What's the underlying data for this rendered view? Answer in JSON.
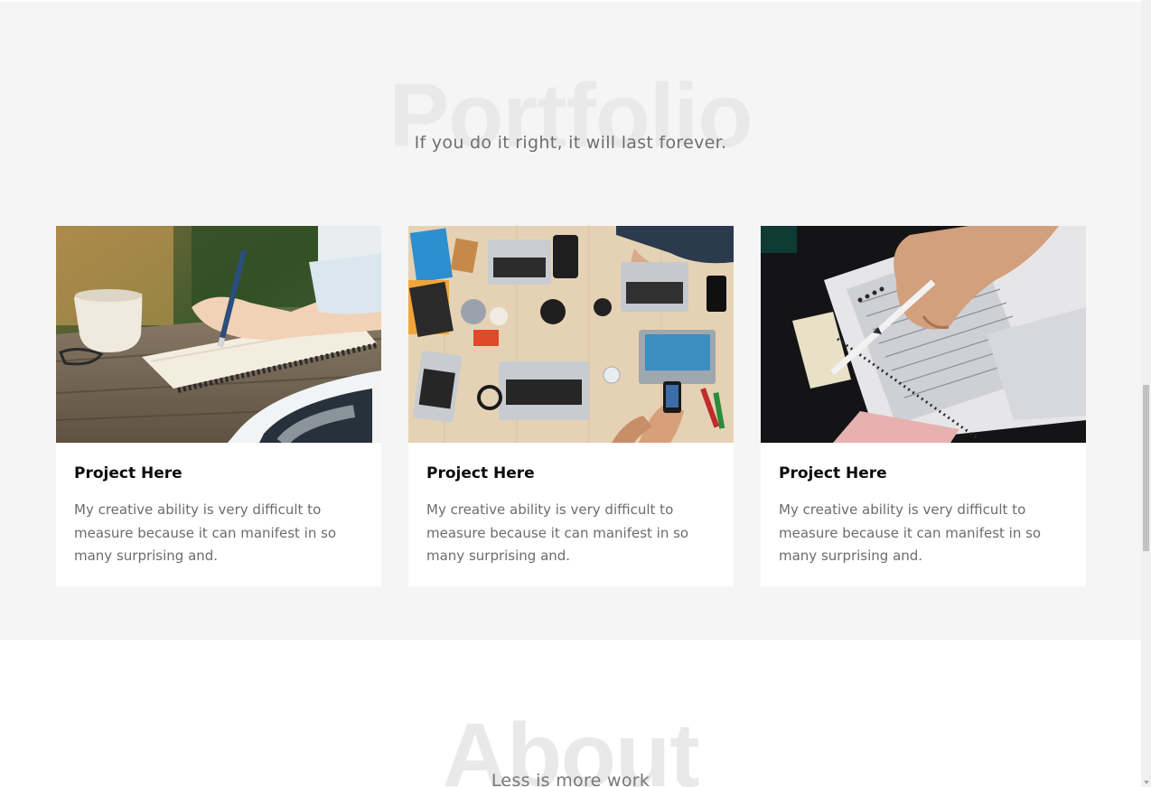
{
  "portfolio": {
    "title": "Portfolio",
    "subtitle": "If you do it right, it will last forever.",
    "cards": [
      {
        "title": "Project Here",
        "description": "My creative ability is very difficult to measure because it can manifest in so many surprising and."
      },
      {
        "title": "Project Here",
        "description": "My creative ability is very difficult to measure because it can manifest in so many surprising and."
      },
      {
        "title": "Project Here",
        "description": "My creative ability is very difficult to measure because it can manifest in so many surprising and."
      }
    ]
  },
  "about": {
    "title": "About",
    "subtitle": "Less is more work"
  },
  "colors": {
    "section_bg": "#f5f5f5",
    "big_title": "#e9e9ea",
    "card_bg": "#ffffff",
    "heading": "#0b0b0b",
    "body_text": "#6c6c6c"
  }
}
